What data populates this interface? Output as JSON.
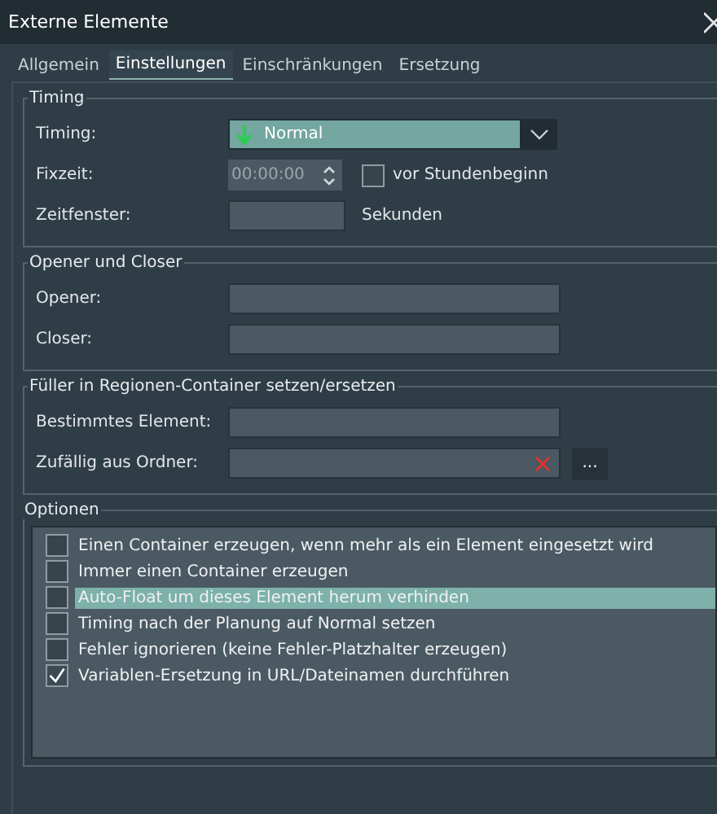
{
  "window": {
    "title": "Externe Elemente"
  },
  "tabs": [
    {
      "label": "Allgemein",
      "selected": false
    },
    {
      "label": "Einstellungen",
      "selected": true
    },
    {
      "label": "Einschränkungen",
      "selected": false
    },
    {
      "label": "Ersetzung",
      "selected": false
    }
  ],
  "groups": [
    {
      "title": "Timing",
      "rows": [
        {
          "kind": "select",
          "label": "Timing:",
          "value": "Normal"
        },
        {
          "kind": "time",
          "label": "Fixzeit:",
          "value": "00:00:00",
          "checkbox": {
            "label": "vor Stundenbeginn",
            "checked": false
          }
        },
        {
          "kind": "number",
          "label": "Zeitfenster:",
          "suffix": "Sekunden"
        }
      ]
    },
    {
      "title": "Opener und Closer",
      "rows": [
        {
          "kind": "text",
          "label": "Opener:"
        },
        {
          "kind": "text",
          "label": "Closer:"
        }
      ]
    },
    {
      "title": "Füller in Regionen-Container setzen/ersetzen",
      "rows": [
        {
          "kind": "text",
          "label": "Bestimmtes Element:"
        },
        {
          "kind": "folder",
          "label": "Zufällig aus Ordner:",
          "button": "..."
        }
      ]
    }
  ],
  "options": {
    "title": "Optionen",
    "items": [
      {
        "label": "Einen Container erzeugen, wenn mehr als ein Element eingesetzt wird",
        "checked": false,
        "selected": false
      },
      {
        "label": "Immer einen Container erzeugen",
        "checked": false,
        "selected": false
      },
      {
        "label": "Auto-Float um dieses Element herum verhinden",
        "checked": false,
        "selected": true
      },
      {
        "label": "Timing nach der Planung auf Normal setzen",
        "checked": false,
        "selected": false
      },
      {
        "label": "Fehler ignorieren (keine Fehler-Platzhalter erzeugen)",
        "checked": false,
        "selected": false
      },
      {
        "label": "Variablen-Ersetzung in URL/Dateinamen durchführen",
        "checked": true,
        "selected": false
      }
    ]
  }
}
